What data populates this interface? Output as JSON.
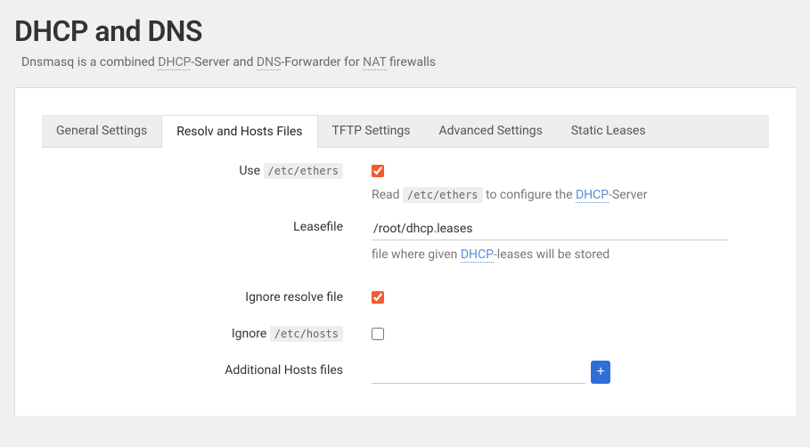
{
  "title": "DHCP and DNS",
  "subtitle": {
    "prefix": "Dnsmasq is a combined ",
    "link1": "DHCP",
    "mid1": "-Server and ",
    "link2": "DNS",
    "mid2": "-Forwarder for ",
    "link3": "NAT",
    "suffix": " firewalls"
  },
  "tabs": {
    "general": "General Settings",
    "resolv": "Resolv and Hosts Files",
    "tftp": "TFTP Settings",
    "advanced": "Advanced Settings",
    "static": "Static Leases"
  },
  "form": {
    "use_ethers": {
      "label_prefix": "Use ",
      "label_code": "/etc/ethers",
      "checked": true,
      "hint_prefix": "Read ",
      "hint_code": "/etc/ethers",
      "hint_mid": " to configure the ",
      "hint_link": "DHCP",
      "hint_suffix": "-Server"
    },
    "leasefile": {
      "label": "Leasefile",
      "value": "/root/dhcp.leases",
      "hint_prefix": "file where given ",
      "hint_link": "DHCP",
      "hint_suffix": "-leases will be stored"
    },
    "ignore_resolve": {
      "label": "Ignore resolve file",
      "checked": true
    },
    "ignore_hosts": {
      "label_prefix": "Ignore ",
      "label_code": "/etc/hosts",
      "checked": false
    },
    "additional_hosts": {
      "label": "Additional Hosts files",
      "value": "",
      "add_label": "+"
    }
  }
}
